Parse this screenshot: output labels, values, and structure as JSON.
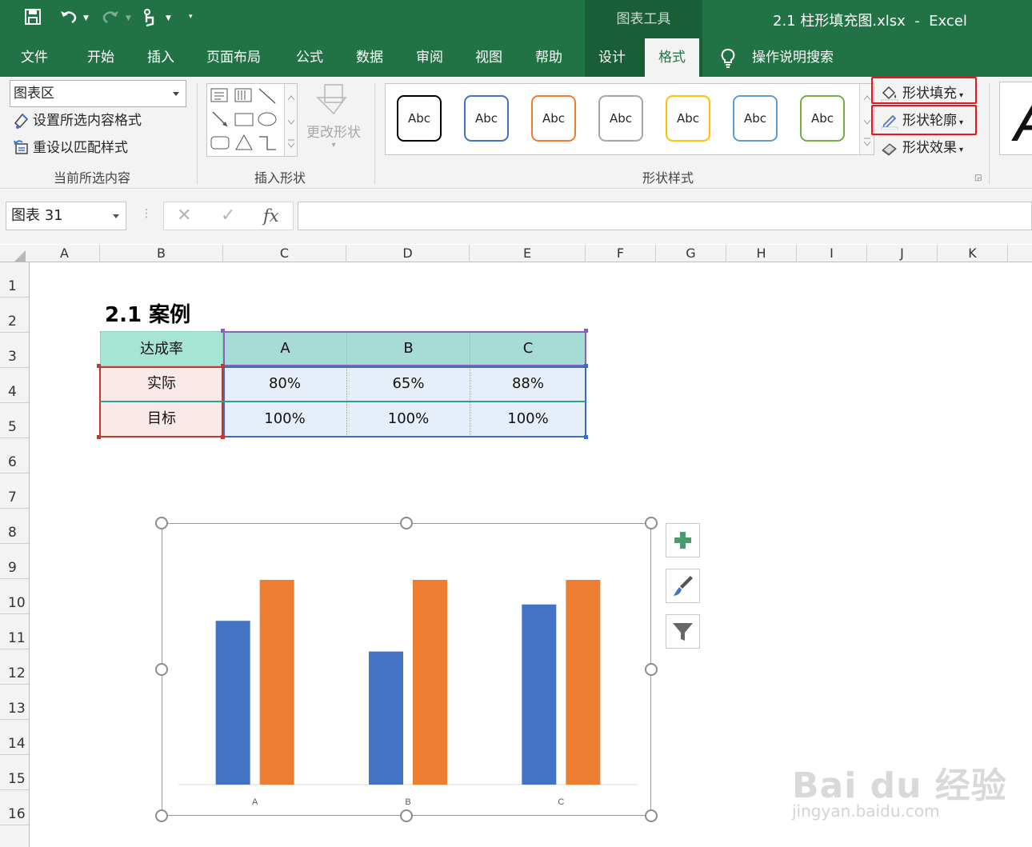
{
  "titlebar": {
    "chart_tools": "图表工具",
    "doc_title": "2.1 柱形填充图.xlsx  -  Excel",
    "qat": [
      "save-icon",
      "undo-icon",
      "redo-icon",
      "touch-mode-icon",
      "customize-qat-icon"
    ]
  },
  "tabs": [
    "文件",
    "开始",
    "插入",
    "页面布局",
    "公式",
    "数据",
    "审阅",
    "视图",
    "帮助",
    "设计",
    "格式"
  ],
  "tell_me": "操作说明搜索",
  "ribbon": {
    "current_selection": {
      "dropdown_value": "图表区",
      "format_selection": "设置所选内容格式",
      "reset_style": "重设以匹配样式",
      "label": "当前所选内容"
    },
    "insert_shapes": {
      "change_shape": "更改形状",
      "label": "插入形状"
    },
    "shape_styles": {
      "swatches": [
        {
          "text": "Abc",
          "color": "#000000"
        },
        {
          "text": "Abc",
          "color": "#4472c4"
        },
        {
          "text": "Abc",
          "color": "#ed7d31"
        },
        {
          "text": "Abc",
          "color": "#a5a5a5"
        },
        {
          "text": "Abc",
          "color": "#ffc000"
        },
        {
          "text": "Abc",
          "color": "#5b9bd5"
        },
        {
          "text": "Abc",
          "color": "#70ad47"
        }
      ],
      "shape_fill": "形状填充",
      "shape_outline": "形状轮廓",
      "shape_effects": "形状效果",
      "label": "形状样式"
    },
    "wordart_sample": "A"
  },
  "formula_bar": {
    "name_box": "图表 31",
    "fx": "fx",
    "formula": ""
  },
  "columns": [
    "A",
    "B",
    "C",
    "D",
    "E",
    "F",
    "G",
    "H",
    "I",
    "J",
    "K"
  ],
  "rows": [
    "1",
    "2",
    "3",
    "4",
    "5",
    "6",
    "7",
    "8",
    "9",
    "10",
    "11",
    "12",
    "13",
    "14",
    "15",
    "16"
  ],
  "sheet": {
    "title": "2.1 案例",
    "table": {
      "corner": "达成率",
      "headers": [
        "A",
        "B",
        "C"
      ],
      "rows": [
        {
          "label": "实际",
          "values": [
            "80%",
            "65%",
            "88%"
          ]
        },
        {
          "label": "目标",
          "values": [
            "100%",
            "100%",
            "100%"
          ]
        }
      ]
    }
  },
  "chart_side_buttons": [
    "add-chart-element-icon",
    "chart-styles-icon",
    "chart-filters-icon"
  ],
  "chart_data": {
    "type": "bar",
    "categories": [
      "A",
      "B",
      "C"
    ],
    "series": [
      {
        "values": [
          0.8,
          0.65,
          0.88
        ],
        "color": "#4472c4"
      },
      {
        "values": [
          1.0,
          1.0,
          1.0
        ],
        "color": "#ed7d31"
      }
    ],
    "ylim": [
      0,
      1
    ],
    "grid": false,
    "legend": "none"
  },
  "watermark": {
    "main": "Bai du 经验",
    "sub": "jingyan.baidu.com"
  },
  "colors": {
    "excel_green": "#217346",
    "highlight_red": "#e8141e"
  }
}
